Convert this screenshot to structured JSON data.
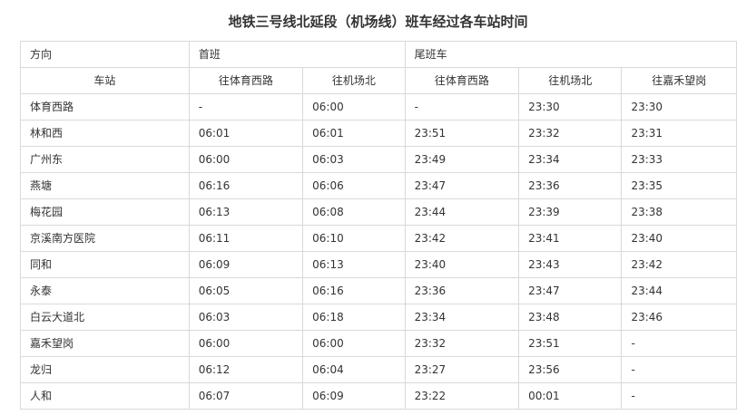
{
  "title": "地铁三号线北延段（机场线）班车经过各车站时间",
  "header": {
    "direction_label": "方向",
    "first_train_label": "首班",
    "last_train_label": "尾班车"
  },
  "sub_header": {
    "station_label": "车站",
    "first_to_tiyuxilu": "往体育西路",
    "first_to_jichangbei": "往机场北",
    "last_to_tiyuxilu": "往体育西路",
    "last_to_jichangbei": "往机场北",
    "last_to_jiahewanggang": "往嘉禾望岗"
  },
  "rows": [
    {
      "station": "体育西路",
      "first_tiyuxilu": "-",
      "first_jichangbei": "06:00",
      "last_tiyuxilu": "-",
      "last_jichangbei": "23:30",
      "last_jiahewanggang": "23:30"
    },
    {
      "station": "林和西",
      "first_tiyuxilu": "06:01",
      "first_jichangbei": "06:01",
      "last_tiyuxilu": "23:51",
      "last_jichangbei": "23:32",
      "last_jiahewanggang": "23:31"
    },
    {
      "station": "广州东",
      "first_tiyuxilu": "06:00",
      "first_jichangbei": "06:03",
      "last_tiyuxilu": "23:49",
      "last_jichangbei": "23:34",
      "last_jiahewanggang": "23:33"
    },
    {
      "station": "燕塘",
      "first_tiyuxilu": "06:16",
      "first_jichangbei": "06:06",
      "last_tiyuxilu": "23:47",
      "last_jichangbei": "23:36",
      "last_jiahewanggang": "23:35"
    },
    {
      "station": "梅花园",
      "first_tiyuxilu": "06:13",
      "first_jichangbei": "06:08",
      "last_tiyuxilu": "23:44",
      "last_jichangbei": "23:39",
      "last_jiahewanggang": "23:38"
    },
    {
      "station": "京溪南方医院",
      "first_tiyuxilu": "06:11",
      "first_jichangbei": "06:10",
      "last_tiyuxilu": "23:42",
      "last_jichangbei": "23:41",
      "last_jiahewanggang": "23:40"
    },
    {
      "station": "同和",
      "first_tiyuxilu": "06:09",
      "first_jichangbei": "06:13",
      "last_tiyuxilu": "23:40",
      "last_jichangbei": "23:43",
      "last_jiahewanggang": "23:42"
    },
    {
      "station": "永泰",
      "first_tiyuxilu": "06:05",
      "first_jichangbei": "06:16",
      "last_tiyuxilu": "23:36",
      "last_jichangbei": "23:47",
      "last_jiahewanggang": "23:44"
    },
    {
      "station": "白云大道北",
      "first_tiyuxilu": "06:03",
      "first_jichangbei": "06:18",
      "last_tiyuxilu": "23:34",
      "last_jichangbei": "23:48",
      "last_jiahewanggang": "23:46"
    },
    {
      "station": "嘉禾望岗",
      "first_tiyuxilu": "06:00",
      "first_jichangbei": "06:00",
      "last_tiyuxilu": "23:32",
      "last_jichangbei": "23:51",
      "last_jiahewanggang": "-"
    },
    {
      "station": "龙归",
      "first_tiyuxilu": "06:12",
      "first_jichangbei": "06:04",
      "last_tiyuxilu": "23:27",
      "last_jichangbei": "23:56",
      "last_jiahewanggang": "-"
    },
    {
      "station": "人和",
      "first_tiyuxilu": "06:07",
      "first_jichangbei": "06:09",
      "last_tiyuxilu": "23:22",
      "last_jichangbei": "00:01",
      "last_jiahewanggang": "-"
    }
  ]
}
